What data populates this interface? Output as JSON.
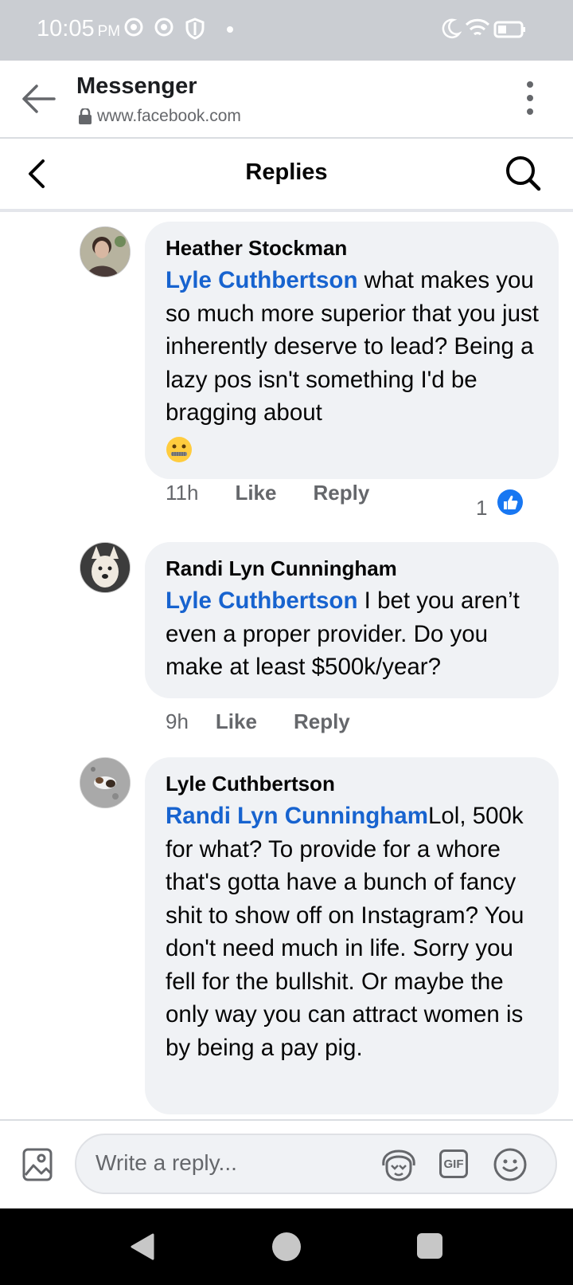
{
  "status_bar": {
    "time": "10:05",
    "ampm": "PM"
  },
  "browser": {
    "title": "Messenger",
    "url": "www.facebook.com",
    "icons": [
      "back-arrow-icon",
      "lock-icon",
      "more-options-icon"
    ]
  },
  "header": {
    "title": "Replies",
    "icons": [
      "chevron-left-icon",
      "search-icon"
    ]
  },
  "comments": [
    {
      "author": "Heather Stockman",
      "mention": "Lyle Cuthbertson",
      "text": " what makes you so much more superior that you just inherently deserve to lead? Being a lazy pos isn't something I'd be bragging about",
      "emoji": "zipper-mouth-face",
      "time": "11h",
      "like_label": "Like",
      "reply_label": "Reply",
      "reaction_count": "1",
      "reaction": "like-icon"
    },
    {
      "author": "Randi Lyn Cunningham",
      "mention": "Lyle Cuthbertson",
      "text": " I bet you aren’t even a proper provider. Do you make at least $500k/year?",
      "time": "9h",
      "like_label": "Like",
      "reply_label": "Reply"
    },
    {
      "author": "Lyle Cuthbertson",
      "mention": "Randi Lyn Cunningham",
      "text": "Lol, 500k for what? To provide for a whore that's gotta have a bunch of fancy shit to show off on Instagram? You don't need much in life. Sorry you fell for the bullshit. Or maybe the only way you can attract women is by being a pay pig."
    }
  ],
  "composer": {
    "placeholder": "Write a reply...",
    "icons": [
      "photo-icon",
      "avatar-sticker-icon",
      "gif-icon",
      "emoji-icon"
    ],
    "gif_label": "GIF"
  },
  "colors": {
    "mention": "#1763cf",
    "like_badge": "#1877f2",
    "bubble": "#f0f2f5"
  }
}
